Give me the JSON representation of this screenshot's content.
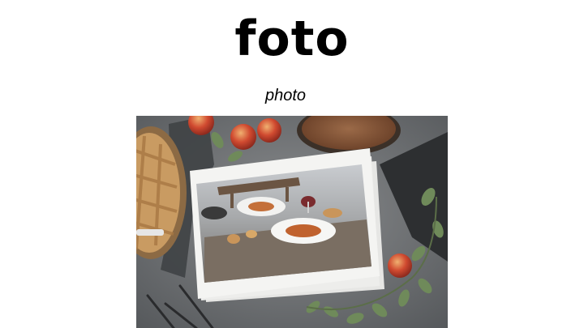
{
  "slide": {
    "title": "foto",
    "subtitle": "photo"
  },
  "image": {
    "subject": "food-photo-flatlay",
    "colors": {
      "table": "#6f7275",
      "print_paper": "#f4f4f2",
      "plate_brown": "#8a5a3a",
      "apple_red": "#c8412f",
      "leaf_green": "#6f8a5a",
      "pie_crust": "#c99b62"
    }
  }
}
